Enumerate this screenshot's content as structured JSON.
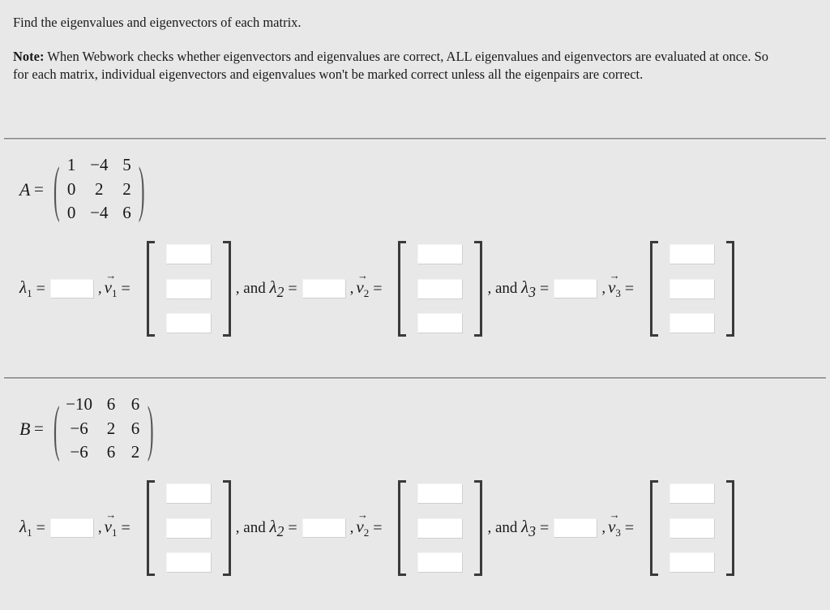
{
  "intro": {
    "prompt": "Find the eigenvalues and eigenvectors of each matrix.",
    "note_label": "Note:",
    "note_text": " When Webwork checks whether eigenvectors and eigenvalues are correct, ALL eigenvalues and eigenvectors are evaluated at once. So for each matrix, individual eigenvectors and eigenvalues won't be marked correct unless all the eigenpairs are correct."
  },
  "symbols": {
    "equals": "=",
    "comma": ",",
    "and_prefix": ", and ",
    "lambda": "λ",
    "vec_letter": "v",
    "vec_arrow": "→",
    "paren_left": "(",
    "paren_right": ")"
  },
  "colors": {
    "background": "#e8e8e8",
    "text": "#1a1a1a",
    "bracket": "#3a3a3a",
    "input_bg": "#ffffff",
    "input_border": "#cfcfcf",
    "divider": "#a9a9a9"
  },
  "sections": [
    {
      "id": "matrix-a",
      "matrix": {
        "name": "A",
        "rows": [
          [
            "1",
            "−4",
            "5"
          ],
          [
            "0",
            "2",
            "2"
          ],
          [
            "0",
            "−4",
            "6"
          ]
        ]
      },
      "eigen": [
        {
          "index": "1",
          "lambda_label": "λ",
          "lambda_sub": "1",
          "lambda_value": "",
          "lambda_placeholder": "",
          "vector_sub": "1",
          "vector_values": [
            "",
            "",
            ""
          ],
          "prefix": ""
        },
        {
          "index": "2",
          "lambda_label": "λ",
          "lambda_sub": "2",
          "lambda_value": "",
          "lambda_placeholder": "",
          "vector_sub": "2",
          "vector_values": [
            "",
            "",
            ""
          ],
          "prefix": ", and "
        },
        {
          "index": "3",
          "lambda_label": "λ",
          "lambda_sub": "3",
          "lambda_value": "",
          "lambda_placeholder": "",
          "vector_sub": "3",
          "vector_values": [
            "",
            "",
            ""
          ],
          "prefix": ", and "
        }
      ]
    },
    {
      "id": "matrix-b",
      "matrix": {
        "name": "B",
        "rows": [
          [
            "−10",
            "6",
            "6"
          ],
          [
            "−6",
            "2",
            "6"
          ],
          [
            "−6",
            "6",
            "2"
          ]
        ]
      },
      "eigen": [
        {
          "index": "1",
          "lambda_label": "λ",
          "lambda_sub": "1",
          "lambda_value": "",
          "lambda_placeholder": "",
          "vector_sub": "1",
          "vector_values": [
            "",
            "",
            ""
          ],
          "prefix": ""
        },
        {
          "index": "2",
          "lambda_label": "λ",
          "lambda_sub": "2",
          "lambda_value": "",
          "lambda_placeholder": "",
          "vector_sub": "2",
          "vector_values": [
            "",
            "",
            ""
          ],
          "prefix": ", and "
        },
        {
          "index": "3",
          "lambda_label": "λ",
          "lambda_sub": "3",
          "lambda_value": "",
          "lambda_placeholder": "",
          "vector_sub": "3",
          "vector_values": [
            "",
            "",
            ""
          ],
          "prefix": ", and "
        }
      ]
    }
  ]
}
